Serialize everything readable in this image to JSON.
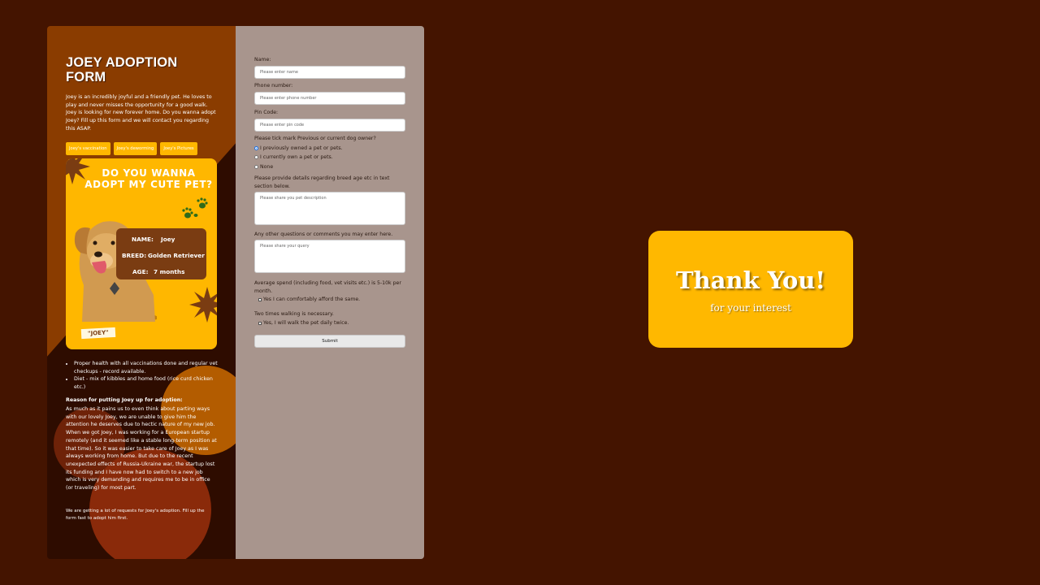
{
  "left": {
    "title": "JOEY ADOPTION FORM",
    "intro": "Joey is an incredibly joyful and a friendly pet. He loves to play and never misses the opportunity for a good walk. Joey is looking for new forever home. Do you wanna adopt Joey? Fill up this form and we will contact you regarding this ASAP.",
    "tabs": [
      "Joey's vaccination",
      "Joey's deworming",
      "Joey's Pictures"
    ],
    "poster": {
      "heading_line1": "DO YOU WANNA",
      "heading_line2": "ADOPT MY CUTE PET?",
      "name_label": "NAME:",
      "name_value": "Joey",
      "breed_label": "BREED:",
      "breed_value": "Golden Retriever",
      "age_label": "AGE:",
      "age_value": "7 months",
      "tag": "\"JOEY\""
    },
    "bullets": [
      "Proper health with all vaccinations done and regular vet checkups - record available.",
      "Diet - mix of kibbles and home food (rice curd chicken etc.)"
    ],
    "reason_heading": "Reason for putting Joey up for adoption:",
    "reason_text": "As much as it pains us to even think about parting ways with our lovely Joey, we are unable to give him the attention he deserves due to hectic nature of my new job. When we got Joey, I was working for a European startup remotely (and it seemed like a stable long-term position at that time). So it was easier to take care of Joey as I was always working from home. But due to the recent unexpected effects of Russia-Ukraine war, the startup lost its funding and I have now had to switch to a new job which is very demanding and requires me to be in office (or traveling) for most part.",
    "note": "We are getting a lot of requests for Joey's adoption. Fill up the form fast to adopt him first."
  },
  "form": {
    "name_label": "Name:",
    "name_placeholder": "Please enter name",
    "phone_label": "Phone number:",
    "phone_placeholder": "Please enter phone number",
    "pin_label": "Pin Code:",
    "pin_placeholder": "Please enter pin code",
    "owner_question": "Please tick mark Previous or current dog owner?",
    "owner_options": [
      "I previously owned a pet or pets.",
      "I currently own a pet or pets.",
      "None"
    ],
    "owner_selected": 0,
    "details_label": "Please provide details regarding breed age etc in text section below.",
    "details_placeholder": "Please share you pet description",
    "questions_label": "Any other questions or comments you may enter here.",
    "questions_placeholder": "Please share your query",
    "spend_label": "Average spend (including food, vet visits etc.) is 5-10k per month.",
    "spend_check": "Yes I can comfortably afford the same.",
    "walk_label": "Two times walking is necessary.",
    "walk_check": "Yes, I will walk the pet daily twice.",
    "submit": "Submit"
  },
  "thanks": {
    "title": "Thank You!",
    "subtitle": "for your interest"
  },
  "colors": {
    "background": "#441400",
    "accent": "#ffb700",
    "form_panel": "#a8958d"
  }
}
